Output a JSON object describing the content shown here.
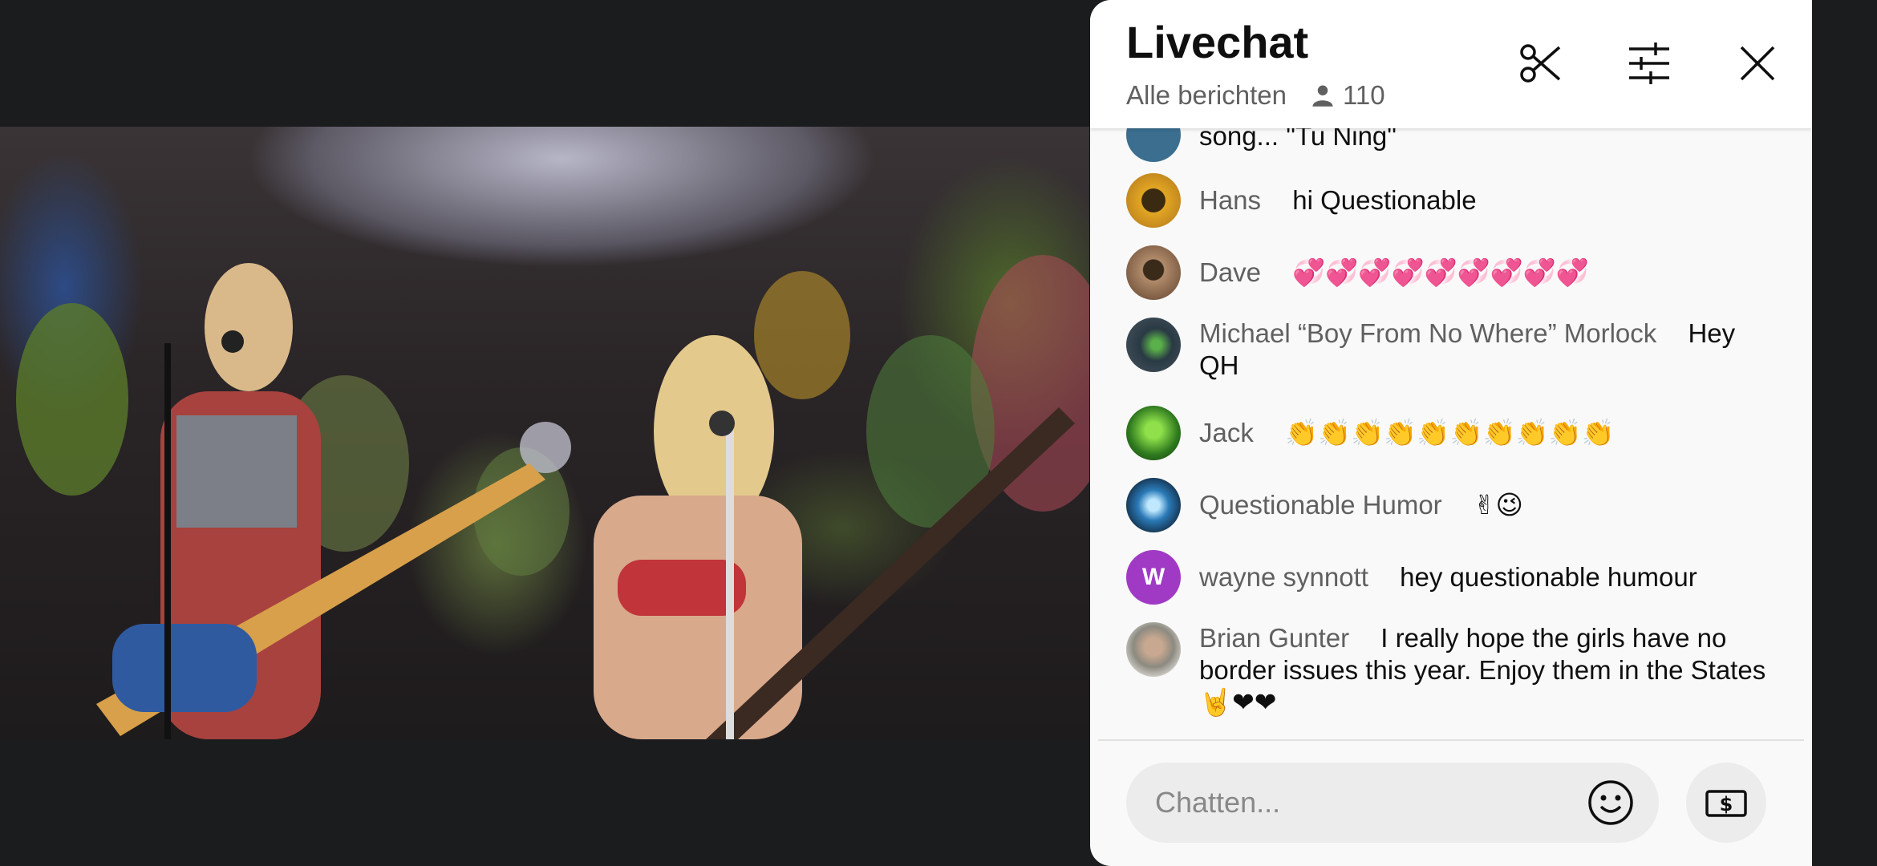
{
  "chat": {
    "title": "Livechat",
    "filter_label": "Alle berichten",
    "viewer_count": "110",
    "header_icons": [
      "scissors-icon",
      "sliders-icon",
      "close-icon"
    ],
    "messages": [
      {
        "author": "",
        "text": "song... \"Tu Ning\"",
        "avatar_color": "#3b6e8f"
      },
      {
        "author": "Hans",
        "text": "hi Questionable",
        "avatar_color": "#c58a1f"
      },
      {
        "author": "Dave",
        "text": "💞💞💞💞💞💞💞💞💞",
        "avatar_color": "#8a6a52"
      },
      {
        "author": "Michael “Boy From No Where” Morlock",
        "text": "Hey QH",
        "avatar_color": "#3d4b55"
      },
      {
        "author": "Jack",
        "text": "👏👏👏👏👏👏👏👏👏👏",
        "avatar_color": "#2f7a1f"
      },
      {
        "author": "Questionable Humor",
        "text": "✌😉",
        "avatar_color": "#1d4d7a"
      },
      {
        "author": "wayne synnott",
        "text": "hey questionable humour",
        "avatar_color": "#a03ac4",
        "avatar_letter": "W"
      },
      {
        "author": "Brian Gunter",
        "text": "I really hope the girls have no border issues this year. Enjoy them in the States 🤘❤❤",
        "avatar_color": "#8c8a80"
      }
    ],
    "input_placeholder": "Chatten..."
  },
  "colors": {
    "panel_bg": "#f9f9f9",
    "header_bg": "#ffffff",
    "author_text": "#606060",
    "body_text": "#0f0f0f"
  }
}
